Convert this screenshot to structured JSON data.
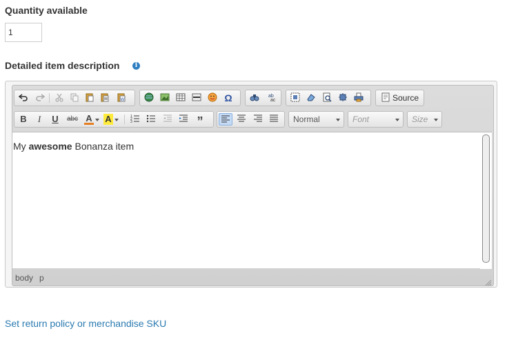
{
  "quantity": {
    "label": "Quantity available",
    "value": "1"
  },
  "description": {
    "label": "Detailed item description",
    "info_icon": "info-icon"
  },
  "toolbar": {
    "row1": [
      "undo-icon",
      "redo-icon",
      "cut-icon",
      "copy-icon",
      "paste-icon",
      "paste-text-icon",
      "paste-word-icon",
      "link-icon",
      "image-icon",
      "table-icon",
      "horizontal-rule-icon",
      "smiley-icon",
      "special-char-icon",
      "find-icon",
      "replace-icon",
      "select-all-icon",
      "remove-format-icon",
      "preview-icon",
      "maximize-icon",
      "print-icon"
    ],
    "source_label": "Source",
    "row2_symbols": {
      "bold": "B",
      "italic": "I",
      "underline": "U",
      "strike": "abc",
      "text_color": "A",
      "bg_color": "A",
      "blockquote": "”"
    },
    "format_value": "Normal",
    "font_placeholder": "Font",
    "size_placeholder": "Size"
  },
  "content": {
    "before": "My ",
    "bold": "awesome",
    "after": " Bonanza item"
  },
  "path": [
    "body",
    "p"
  ],
  "return_link": "Set return policy or merchandise SKU"
}
